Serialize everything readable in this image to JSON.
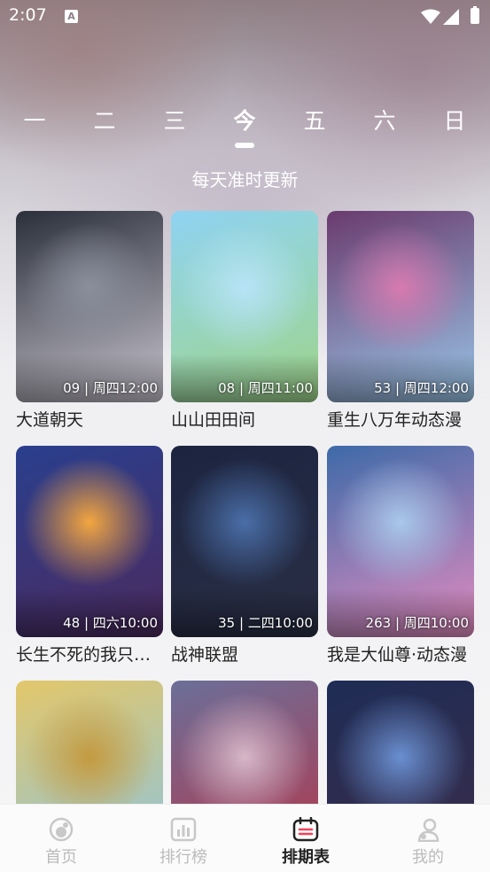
{
  "status_bar": {
    "time": "2:07",
    "notification_glyph": "A"
  },
  "day_tabs": [
    {
      "label": "一"
    },
    {
      "label": "二"
    },
    {
      "label": "三"
    },
    {
      "label": "今",
      "active": true
    },
    {
      "label": "五"
    },
    {
      "label": "六"
    },
    {
      "label": "日"
    }
  ],
  "subtitle": "每天准时更新",
  "cards": [
    {
      "title": "大道朝天",
      "meta": "09 | 周四12:00",
      "colors": [
        "#2a2f3a",
        "#8a8f9c",
        "#c9c5cf"
      ]
    },
    {
      "title": "山山田田间",
      "meta": "08 | 周四11:00",
      "colors": [
        "#8fd3f2",
        "#b7e4f7",
        "#9fd58a"
      ]
    },
    {
      "title": "重生八万年动态漫",
      "meta": "53 | 周四12:00",
      "colors": [
        "#6a3b6e",
        "#d77ab0",
        "#9ac6e8"
      ]
    },
    {
      "title": "长生不死的我只想苟",
      "meta": "48 | 四六10:00",
      "colors": [
        "#2a3f8e",
        "#f3a640",
        "#4b2a5e"
      ]
    },
    {
      "title": "战神联盟",
      "meta": "35 | 二四10:00",
      "colors": [
        "#1c2440",
        "#4a6ea8",
        "#2a2f45"
      ]
    },
    {
      "title": "我是大仙尊·动态漫",
      "meta": "263 | 周四10:00",
      "colors": [
        "#3d6aa8",
        "#a9c8ea",
        "#e38cc0"
      ]
    },
    {
      "title": "",
      "meta": "",
      "colors": [
        "#e3c76a",
        "#c49a40",
        "#8bc4e0"
      ]
    },
    {
      "title": "",
      "meta": "",
      "colors": [
        "#6b6f99",
        "#d7b7c8",
        "#b5364a"
      ]
    },
    {
      "title": "",
      "meta": "",
      "colors": [
        "#1e2c55",
        "#6a8fd0",
        "#3b2d4a"
      ]
    }
  ],
  "bottom_nav": [
    {
      "label": "首页",
      "icon": "home-icon"
    },
    {
      "label": "排行榜",
      "icon": "ranking-icon"
    },
    {
      "label": "排期表",
      "icon": "calendar-icon",
      "active": true
    },
    {
      "label": "我的",
      "icon": "profile-icon"
    }
  ],
  "colors": {
    "accent": "#f2435a",
    "text_dark": "#222222",
    "nav_inactive": "#bbbbbb"
  }
}
